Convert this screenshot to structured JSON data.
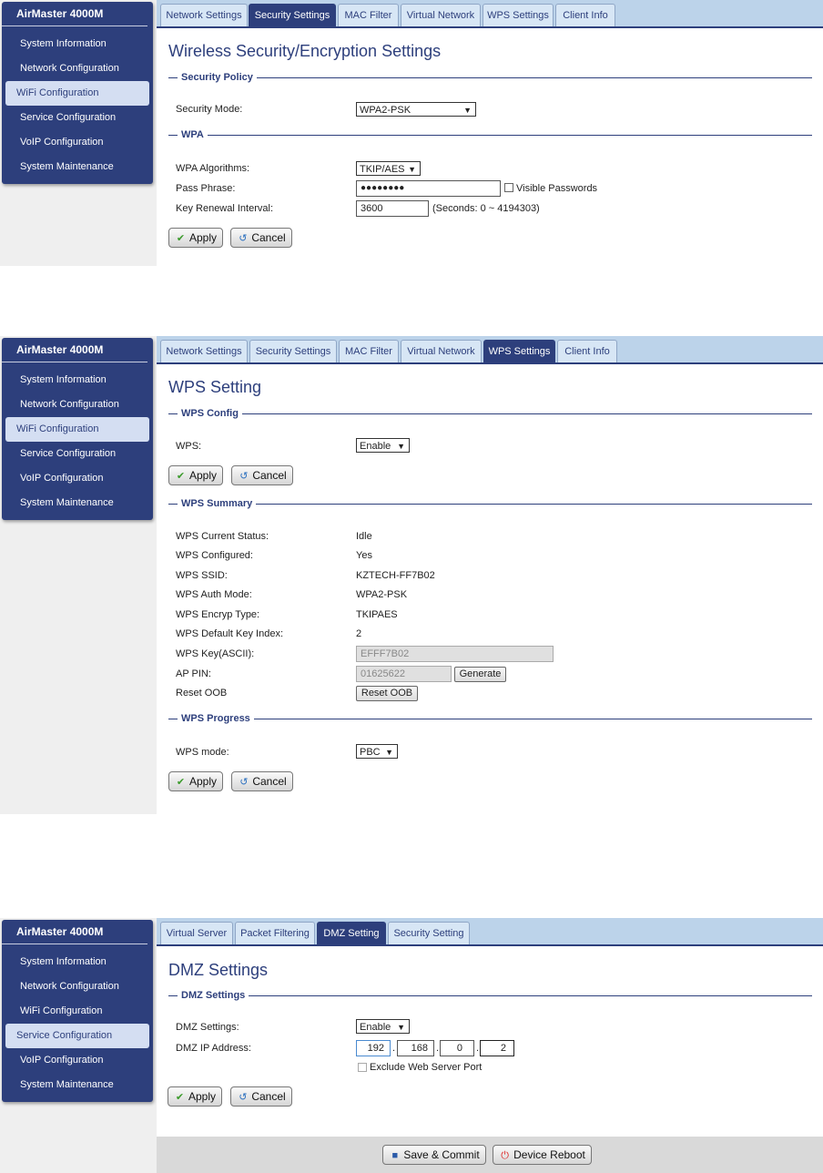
{
  "brand": "AirMaster 4000M",
  "sidebar_items": [
    "System Information",
    "Network Configuration",
    "WiFi Configuration",
    "Service Configuration",
    "VoIP Configuration",
    "System Maintenance"
  ],
  "wifi_tabs": [
    "Network Settings",
    "Security Settings",
    "MAC Filter",
    "Virtual Network",
    "WPS Settings",
    "Client Info"
  ],
  "service_tabs": [
    "Virtual Server",
    "Packet Filtering",
    "DMZ Setting",
    "Security Setting"
  ],
  "buttons": {
    "apply": "Apply",
    "cancel": "Cancel"
  },
  "security": {
    "title": "Wireless Security/Encryption Settings",
    "section_policy": "Security Policy",
    "security_mode_label": "Security Mode:",
    "security_mode_value": "WPA2-PSK",
    "section_wpa": "WPA",
    "wpa_alg_label": "WPA Algorithms:",
    "wpa_alg_value": "TKIP/AES",
    "pass_label": "Pass Phrase:",
    "pass_value": "●●●●●●●●",
    "visible_pw_label": "Visible Passwords",
    "renew_label": "Key Renewal Interval:",
    "renew_value": "3600",
    "renew_hint": "(Seconds: 0 ~ 4194303)"
  },
  "wps": {
    "title": "WPS Setting",
    "section_config": "WPS Config",
    "wps_label": "WPS:",
    "wps_value": "Enable",
    "section_summary": "WPS Summary",
    "summary": [
      {
        "label": "WPS Current Status:",
        "value": "Idle"
      },
      {
        "label": "WPS Configured:",
        "value": "Yes"
      },
      {
        "label": "WPS SSID:",
        "value": "KZTECH-FF7B02"
      },
      {
        "label": "WPS Auth Mode:",
        "value": "WPA2-PSK"
      },
      {
        "label": "WPS Encryp Type:",
        "value": "TKIPAES"
      },
      {
        "label": "WPS Default Key Index:",
        "value": "2"
      }
    ],
    "key_label": "WPS Key(ASCII):",
    "key_value": "EFFF7B02",
    "pin_label": "AP PIN:",
    "pin_value": "01625622",
    "generate_label": "Generate",
    "reset_label": "Reset OOB",
    "reset_button": "Reset OOB",
    "section_progress": "WPS Progress",
    "mode_label": "WPS mode:",
    "mode_value": "PBC"
  },
  "dmz": {
    "title": "DMZ Settings",
    "section": "DMZ Settings",
    "settings_label": "DMZ Settings:",
    "settings_value": "Enable",
    "ip_label": "DMZ IP Address:",
    "ip": [
      "192",
      "168",
      "0",
      "2"
    ],
    "exclude_label": "Exclude Web Server Port"
  },
  "footer": {
    "save": "Save & Commit",
    "reboot": "Device Reboot"
  }
}
